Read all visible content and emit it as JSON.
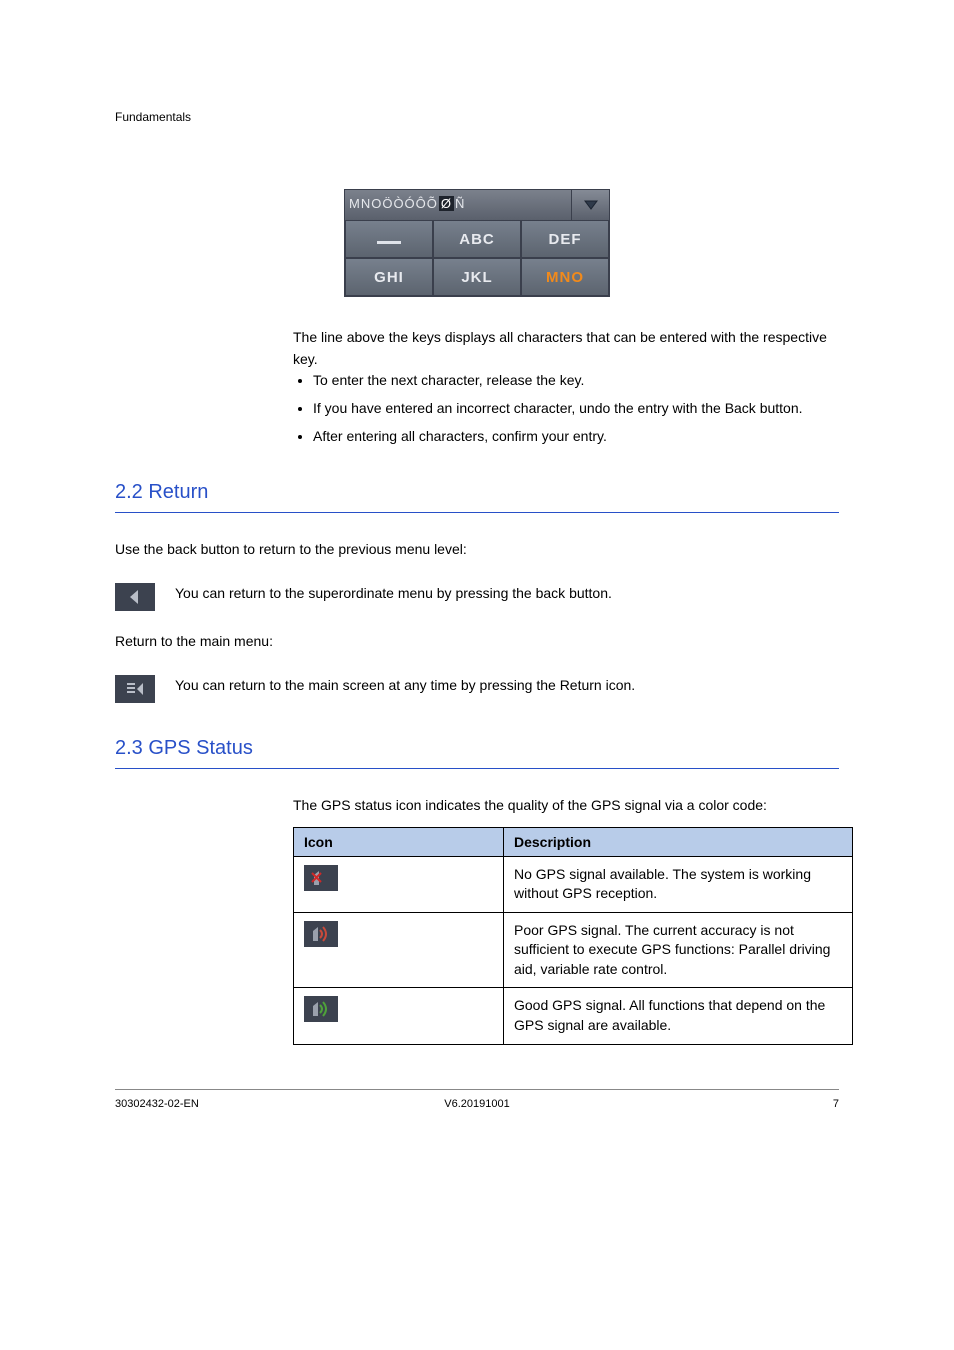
{
  "chapter": "Fundamentals",
  "keypad": {
    "display_plain": "MNOÖÒÓÔÕ",
    "display_hi": "Ø",
    "display_tail": "Ñ",
    "keys": [
      "_",
      "ABC",
      "DEF",
      "GHI",
      "JKL",
      "MNO"
    ],
    "selected": "MNO"
  },
  "fig_note1": "The line above the keys displays all characters that can be entered with the respective key.",
  "bullets": [
    "To enter the next character, release the key.",
    "If you have entered an incorrect character, undo the entry with the Back button.",
    "After entering all characters, confirm your entry."
  ],
  "section2": {
    "title": "2.2   Return",
    "p1": "Use the back button to return to the previous menu level:",
    "btn_back_desc": "You can return to the superordinate menu by pressing the back button.",
    "p2": "Return to the main menu:",
    "btn_home_desc": "You can return to the main screen at any time by pressing the Return icon."
  },
  "section3": {
    "title": "2.3   GPS Status",
    "lead": "The GPS status icon indicates the quality of the GPS signal via a color code:",
    "th_icon": "Icon",
    "th_desc": "Description",
    "rows": [
      "No GPS signal available. The system is working without GPS reception.",
      "Poor GPS signal. The current accuracy is not sufficient to execute GPS functions: Parallel driving aid, variable rate control.",
      "Good GPS signal. All functions that depend on the GPS signal are available."
    ]
  },
  "footer": {
    "left": "30302432-02-EN",
    "center": "V6.20191001",
    "right": "7"
  }
}
